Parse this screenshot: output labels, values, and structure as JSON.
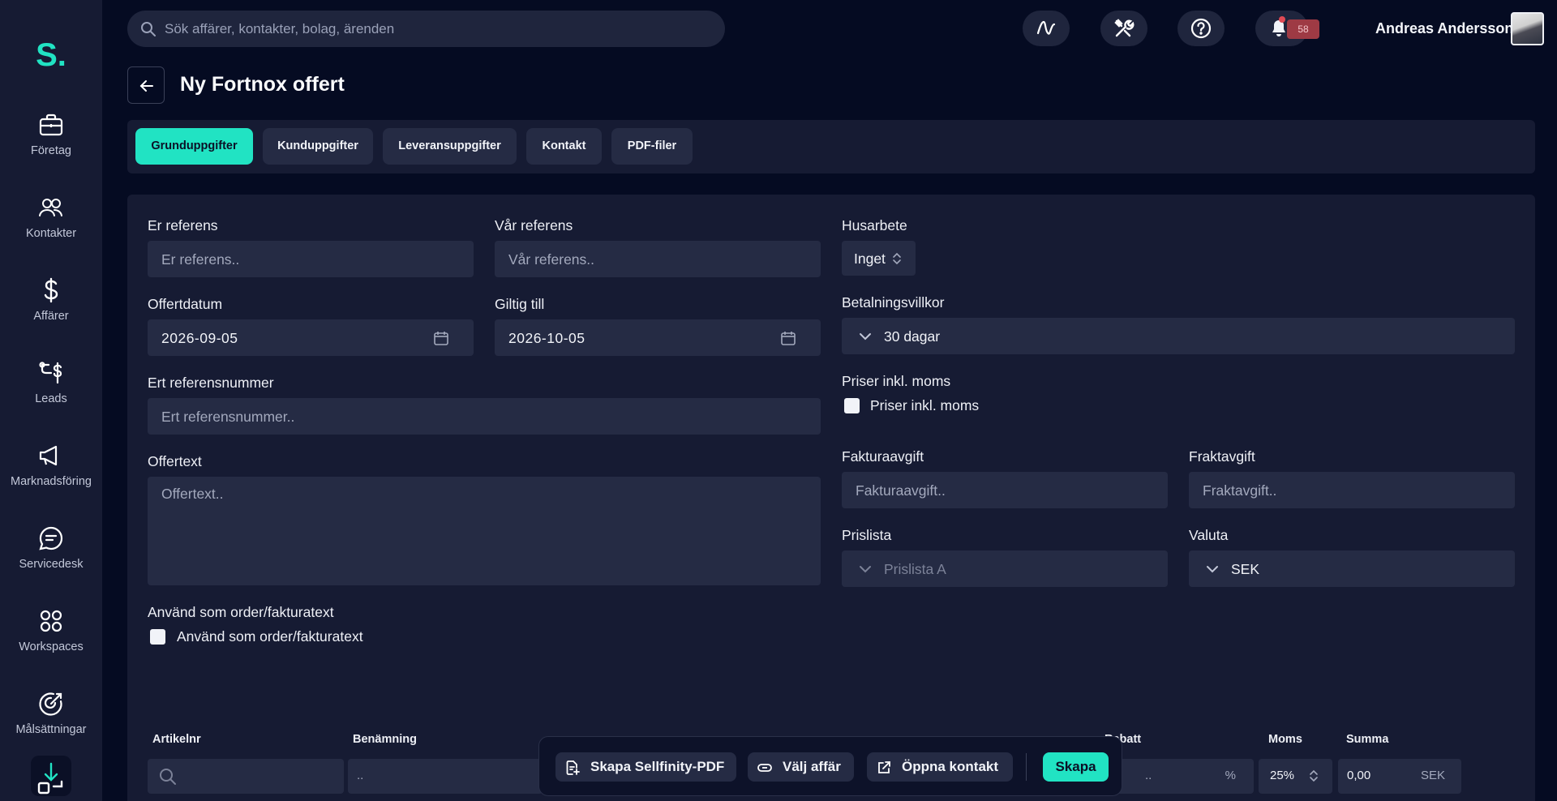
{
  "app": {
    "logo": "S."
  },
  "sidebar": {
    "items": [
      {
        "label": "Företag",
        "icon": "briefcase-icon"
      },
      {
        "label": "Kontakter",
        "icon": "users-icon"
      },
      {
        "label": "Affärer",
        "icon": "dollar-icon"
      },
      {
        "label": "Leads",
        "icon": "leads-icon"
      },
      {
        "label": "Marknadsföring",
        "icon": "megaphone-icon"
      },
      {
        "label": "Servicedesk",
        "icon": "chat-icon"
      },
      {
        "label": "Workspaces",
        "icon": "grid-icon"
      },
      {
        "label": "Målsättningar",
        "icon": "target-icon"
      }
    ]
  },
  "topbar": {
    "search_placeholder": "Sök affärer, kontakter, bolag, ärenden",
    "notification_count": "58",
    "user_name": "Andreas Andersson"
  },
  "page": {
    "title": "Ny Fortnox offert"
  },
  "tabs": [
    "Grunduppgifter",
    "Kunduppgifter",
    "Leveransuppgifter",
    "Kontakt",
    "PDF-filer"
  ],
  "form": {
    "er_referens": {
      "label": "Er referens",
      "placeholder": "Er referens.."
    },
    "var_referens": {
      "label": "Vår referens",
      "placeholder": "Vår referens.."
    },
    "husarbete": {
      "label": "Husarbete",
      "value": "Inget"
    },
    "offertdatum": {
      "label": "Offertdatum",
      "value": "2026-09-05"
    },
    "giltig_till": {
      "label": "Giltig till",
      "value": "2026-10-05"
    },
    "betalningsvillkor": {
      "label": "Betalningsvillkor",
      "value": "30 dagar"
    },
    "priser_inkl_moms": {
      "label": "Priser inkl. moms",
      "checkbox_label": "Priser inkl. moms"
    },
    "ert_referensnummer": {
      "label": "Ert referensnummer",
      "placeholder": "Ert referensnummer.."
    },
    "offertext": {
      "label": "Offertext",
      "placeholder": "Offertext.."
    },
    "fakturaavgift": {
      "label": "Fakturaavgift",
      "placeholder": "Fakturaavgift.."
    },
    "fraktavgift": {
      "label": "Fraktavgift",
      "placeholder": "Fraktavgift.."
    },
    "prislista": {
      "label": "Prislista",
      "placeholder": "Prislista A"
    },
    "valuta": {
      "label": "Valuta",
      "value": "SEK"
    },
    "anvand_som_order": {
      "label": "Använd som order/fakturatext",
      "checkbox_label": "Använd som order/fakturatext"
    }
  },
  "table": {
    "headers": {
      "artikelnr": "Artikelnr",
      "benamning": "Benämning",
      "rabatt": "Rabatt",
      "moms": "Moms",
      "summa": "Summa"
    },
    "row": {
      "benamning_placeholder": "..",
      "rabatt_placeholder": "..",
      "rabatt_unit": "%",
      "moms": "25%",
      "summa": "0,00",
      "currency": "SEK"
    }
  },
  "actions": {
    "skapa_pdf": "Skapa Sellfinity-PDF",
    "valj_affar": "Välj affär",
    "oppna_kontakt": "Öppna kontakt",
    "skapa": "Skapa"
  },
  "colors": {
    "accent": "#21e3c3",
    "background": "#050b22",
    "panel": "#161b33",
    "field": "#252b44",
    "badge": "#9e3a44"
  }
}
